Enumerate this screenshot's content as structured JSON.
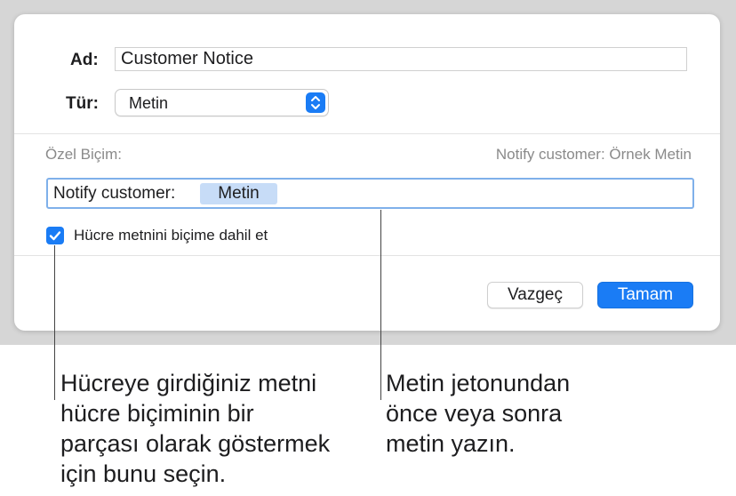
{
  "dialog": {
    "name_label": "Ad:",
    "name_value": "Customer Notice",
    "type_label": "Tür:",
    "type_value": "Metin",
    "custom_format_label": "Özel Biçim:",
    "preview_text": "Notify customer: Örnek Metin",
    "format_prefix": "Notify customer:",
    "format_token": "Metin",
    "include_cell_text": {
      "label": "Hücre metnini biçime dahil et",
      "checked": true
    },
    "cancel_label": "Vazgeç",
    "ok_label": "Tamam"
  },
  "callouts": {
    "left": "Hücreye girdiğiniz metni\nhücre biçiminin bir\nparçası olarak göstermek\niçin bunu seçin.",
    "right": "Metin jetonundan\nönce veya sonra\nmetin yazın."
  },
  "colors": {
    "accent": "#1a7cf5",
    "token_bg": "#c7dcf7",
    "focus_ring": "#7fb0ea"
  }
}
